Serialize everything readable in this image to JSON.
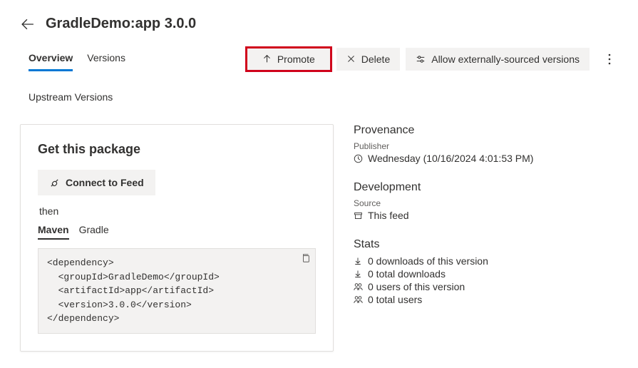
{
  "header": {
    "title": "GradleDemo:app 3.0.0"
  },
  "tabs": {
    "overview": "Overview",
    "versions": "Versions"
  },
  "actions": {
    "promote": "Promote",
    "delete": "Delete",
    "allow_external": "Allow externally-sourced versions"
  },
  "subheading": "Upstream Versions",
  "card": {
    "title": "Get this package",
    "connect": "Connect to Feed",
    "then": "then",
    "subtabs": {
      "maven": "Maven",
      "gradle": "Gradle"
    },
    "code": "<dependency>\n  <groupId>GradleDemo</groupId>\n  <artifactId>app</artifactId>\n  <version>3.0.0</version>\n</dependency>"
  },
  "provenance": {
    "heading": "Provenance",
    "publisher_label": "Publisher",
    "published_at": "Wednesday (10/16/2024 4:01:53 PM)"
  },
  "development": {
    "heading": "Development",
    "source_label": "Source",
    "source_value": "This feed"
  },
  "stats": {
    "heading": "Stats",
    "downloads_version": "0 downloads of this version",
    "downloads_total": "0 total downloads",
    "users_version": "0 users of this version",
    "users_total": "0 total users"
  }
}
